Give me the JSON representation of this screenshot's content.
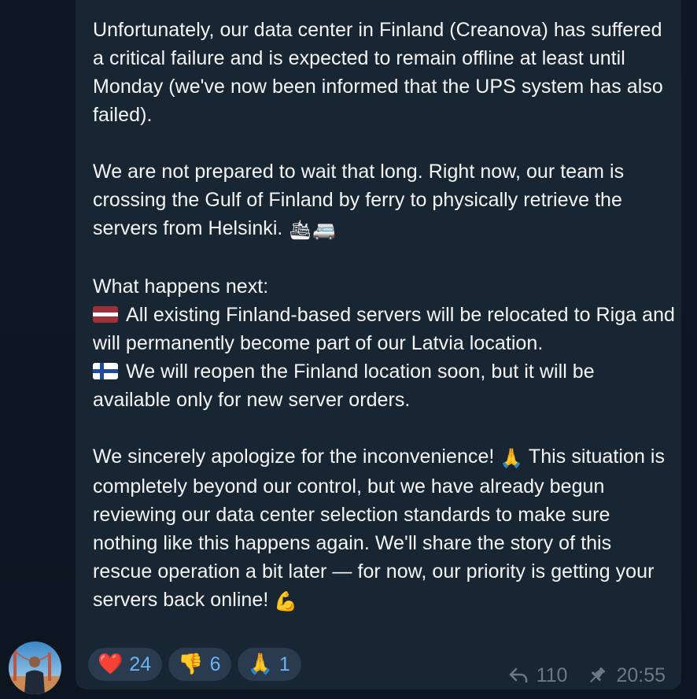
{
  "message": {
    "para1": "Unfortunately, our data center in Finland (Creanova) has suffered a critical failure and is expected to remain offline at least until Monday (we've now been informed that the UPS system has also failed).",
    "para2": "We are not prepared to wait that long. Right now, our team is crossing the Gulf of Finland by ferry to physically retrieve the servers from Helsinki.",
    "para2_emoji": "🛳🚐",
    "para3_heading": "What happens next:",
    "para3_item1": "All existing Finland-based servers will be relocated to Riga and will permanently become part of our Latvia location.",
    "para3_item2": "We will reopen the Finland location soon, but it will be available only for new server orders.",
    "para4_a": "We sincerely apologize for the inconvenience!",
    "para4_emoji": "🙏",
    "para4_b": "This situation is completely beyond our control, but we have already begun reviewing our data center selection standards to make sure nothing like this happens again. We'll share the story of this rescue operation a bit later — for now, our priority is getting your servers back online!",
    "para4_end_emoji": "💪"
  },
  "reactions": [
    {
      "emoji": "❤️",
      "count": "24"
    },
    {
      "emoji": "👎",
      "count": "6"
    },
    {
      "emoji": "🙏",
      "count": "1"
    }
  ],
  "meta": {
    "forwards": "110",
    "time": "20:55",
    "forward_icon": "reply-arrow-icon",
    "pin_icon": "pin-icon"
  },
  "colors": {
    "bubble": "#182533",
    "text": "#f5f5f5",
    "reaction_bg": "#2b3b4f",
    "reaction_count": "#6ab3f3",
    "meta": "#6c7883"
  }
}
